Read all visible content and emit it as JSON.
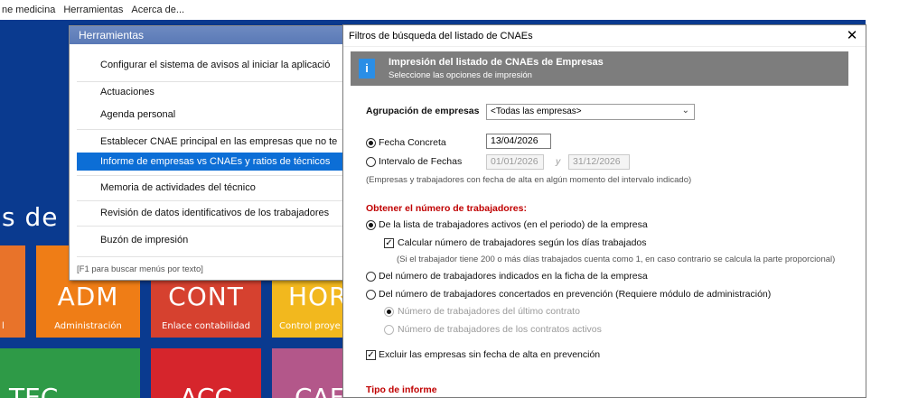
{
  "menubar": {
    "items": [
      "ne medicina",
      "Herramientas",
      "Acerca de..."
    ]
  },
  "desktop": {
    "title_fragment": "s de",
    "tiles": [
      {
        "code": "",
        "name": "l",
        "color": "#e8732a"
      },
      {
        "code": "ADM",
        "name": "Administración",
        "color": "#ef7d16"
      },
      {
        "code": "CONT",
        "name": "Enlace contabilidad",
        "color": "#d6412f"
      },
      {
        "code": "HOR",
        "name": "Control proye",
        "color": "#f2b81e"
      },
      {
        "code": "TEC",
        "name": "",
        "color": "#2e9a47"
      },
      {
        "code": "ACC",
        "name": "",
        "color": "#d6252c"
      },
      {
        "code": "CAF",
        "name": "",
        "color": "#b3578a"
      }
    ]
  },
  "tools": {
    "title": "Herramientas",
    "items": [
      "Configurar el sistema de avisos al iniciar la aplicació",
      "Actuaciones",
      "Agenda personal",
      "Establecer CNAE principal en las empresas que no te",
      "Informe de empresas vs CNAEs y ratios de técnicos",
      "Memoria de actividades del técnico",
      "Revisión de datos identificativos de los trabajadores",
      "Buzón de impresión"
    ],
    "hint": "[F1 para buscar menús por texto]"
  },
  "dialog": {
    "title": "Filtros de búsqueda del listado de CNAEs",
    "close": "✕",
    "banner_icon": "i",
    "banner_title": "Impresión del listado de CNAEs de Empresas",
    "banner_sub": "Seleccione las opciones de impresión",
    "agrup_label": "Agrupación de empresas",
    "agrup_value": "<Todas las empresas>",
    "fecha_concreta_label": "Fecha Concreta",
    "fecha_concreta_value": "13/04/2026",
    "intervalo_label": "Intervalo de Fechas",
    "intervalo_from": "01/01/2026",
    "intervalo_sep": "y",
    "intervalo_to": "31/12/2026",
    "intervalo_note": "(Empresas y trabajadores con fecha de alta en algún momento del intervalo indicado)",
    "section_workers": "Obtener el número de trabajadores:",
    "opt_activos": "De la lista de trabajadores activos (en el periodo) de la empresa",
    "chk_calcular": "Calcular número de trabajadores según los días trabajados",
    "calcular_note": "(Si el trabajador tiene 200 o más días trabajados cuenta como 1, en caso contrario se calcula la parte proporcional)",
    "opt_ficha": "Del número de trabajadores indicados en la ficha de la empresa",
    "opt_concertados": "Del número de trabajadores concertados en prevención (Requiere módulo de administración)",
    "sub_ultimo": "Número de trabajadores del último contrato",
    "sub_activos": "Número de trabajadores de los contratos activos",
    "chk_excluir": "Excluir las empresas sin fecha de alta en prevención",
    "section_tipo": "Tipo de informe"
  }
}
